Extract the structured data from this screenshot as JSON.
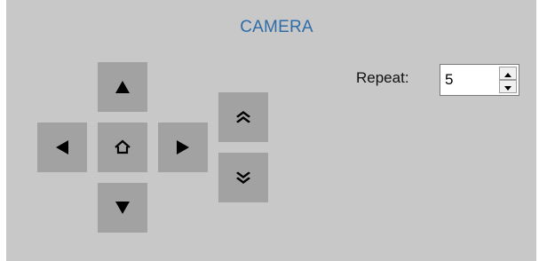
{
  "panel": {
    "title": "CAMERA"
  },
  "controls": {
    "up_icon": "triangle-up-icon",
    "down_icon": "triangle-down-icon",
    "left_icon": "triangle-left-icon",
    "right_icon": "triangle-right-icon",
    "home_icon": "home-icon",
    "zoom_in_icon": "double-chevron-up-icon",
    "zoom_out_icon": "double-chevron-down-icon"
  },
  "repeat": {
    "label": "Repeat:",
    "value": "5"
  },
  "colors": {
    "panel_bg": "#c8c8c8",
    "button_bg": "#a2a2a2",
    "title": "#2e6ca6"
  }
}
